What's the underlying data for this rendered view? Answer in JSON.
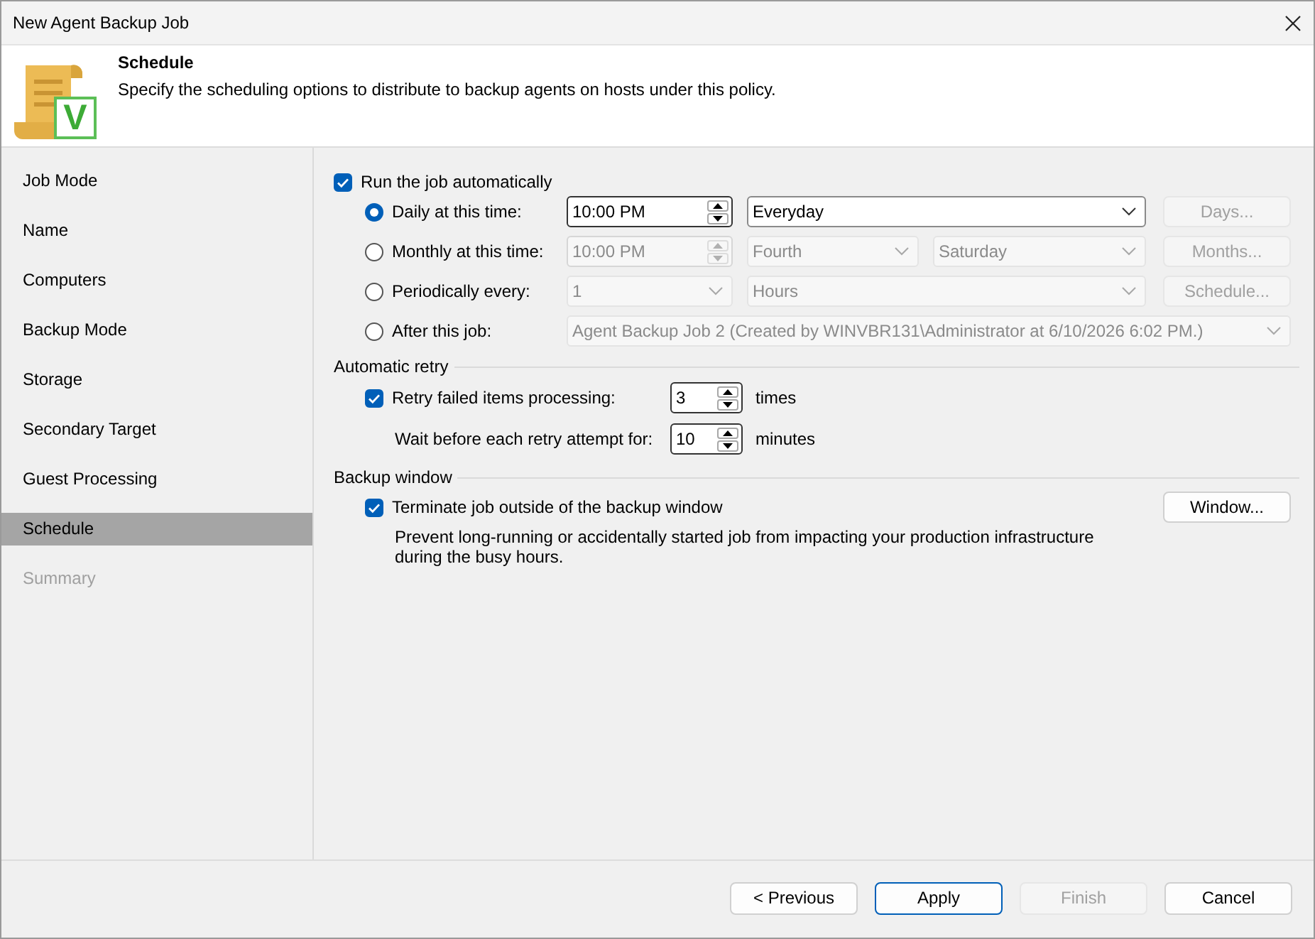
{
  "window": {
    "title": "New Agent Backup Job"
  },
  "header": {
    "title": "Schedule",
    "description": "Specify the scheduling options to distribute to backup agents on hosts under this policy.",
    "logo_letter": "V"
  },
  "steps": [
    {
      "label": "Job Mode",
      "selected": false,
      "disabled": false
    },
    {
      "label": "Name",
      "selected": false,
      "disabled": false
    },
    {
      "label": "Computers",
      "selected": false,
      "disabled": false
    },
    {
      "label": "Backup Mode",
      "selected": false,
      "disabled": false
    },
    {
      "label": "Storage",
      "selected": false,
      "disabled": false
    },
    {
      "label": "Secondary Target",
      "selected": false,
      "disabled": false
    },
    {
      "label": "Guest Processing",
      "selected": false,
      "disabled": false
    },
    {
      "label": "Schedule",
      "selected": true,
      "disabled": false
    },
    {
      "label": "Summary",
      "selected": false,
      "disabled": true
    }
  ],
  "run_automatically": {
    "label": "Run the job automatically",
    "checked": true
  },
  "schedule_options": [
    {
      "label": "Daily at this time:",
      "selected": true,
      "controls": [
        {
          "kind": "spin",
          "value": "10:00 PM",
          "disabled": false
        },
        {
          "kind": "dropdown",
          "value": "Everyday",
          "disabled": false
        },
        {
          "kind": "button",
          "label": "Days...",
          "disabled": true
        }
      ]
    },
    {
      "label": "Monthly at this time:",
      "selected": false,
      "controls": [
        {
          "kind": "spin",
          "value": "10:00 PM",
          "disabled": true
        },
        {
          "kind": "dropdown",
          "value": "Fourth",
          "disabled": true
        },
        {
          "kind": "dropdown",
          "value": "Saturday",
          "disabled": true
        },
        {
          "kind": "button",
          "label": "Months...",
          "disabled": true
        }
      ]
    },
    {
      "label": "Periodically every:",
      "selected": false,
      "controls": [
        {
          "kind": "dropdown",
          "value": "1",
          "disabled": true
        },
        {
          "kind": "dropdown",
          "value": "Hours",
          "disabled": true
        },
        {
          "kind": "button",
          "label": "Schedule...",
          "disabled": true
        }
      ]
    },
    {
      "label": "After this job:",
      "selected": false,
      "controls": [
        {
          "kind": "dropdown",
          "value": "Agent Backup Job 2 (Created by WINVBR131\\Administrator at 6/10/2026 6:02 PM.)",
          "disabled": true
        }
      ]
    }
  ],
  "automatic_retry": {
    "title": "Automatic retry",
    "retry": {
      "label": "Retry failed items processing:",
      "checked": true,
      "value": "3",
      "unit": "times"
    },
    "wait": {
      "label": "Wait before each retry attempt for:",
      "value": "10",
      "unit": "minutes"
    }
  },
  "backup_window": {
    "title": "Backup window",
    "terminate": {
      "label": "Terminate job outside of the backup window",
      "checked": true
    },
    "description": "Prevent long-running or accidentally started job from impacting your production infrastructure during the busy hours.",
    "button": {
      "label": "Window...",
      "disabled": false
    }
  },
  "footer_buttons": [
    {
      "label": "< Previous",
      "default": false,
      "disabled": false
    },
    {
      "label": "Apply",
      "default": true,
      "disabled": false
    },
    {
      "label": "Finish",
      "default": false,
      "disabled": true
    },
    {
      "label": "Cancel",
      "default": false,
      "disabled": false
    }
  ]
}
